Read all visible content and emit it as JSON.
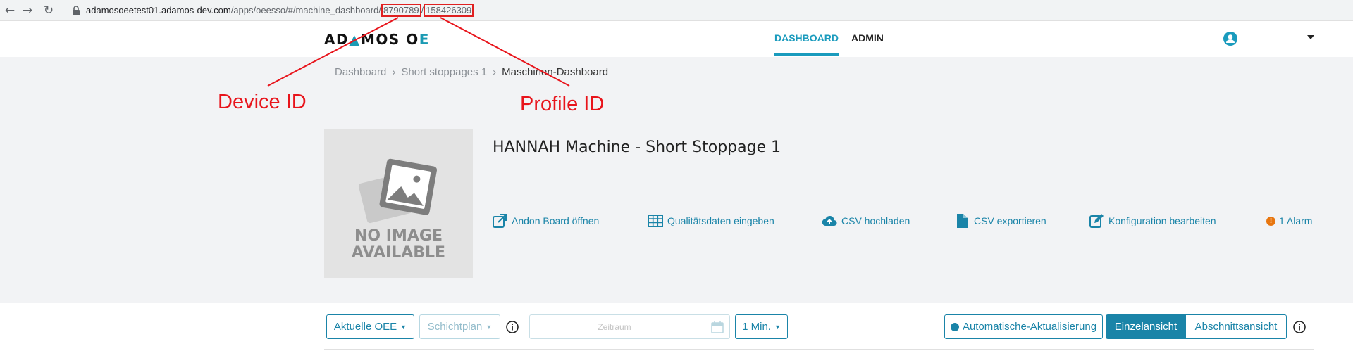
{
  "browser": {
    "back_icon": "back-arrow-icon",
    "forward_icon": "forward-arrow-icon",
    "reload_icon": "reload-icon",
    "url_host": "adamosoeetest01.adamos-dev.com",
    "url_path": "/apps/oeesso/#/machine_dashboard/",
    "url_device_id": "8790789",
    "url_separator": "/",
    "url_profile_id": "158426309"
  },
  "header": {
    "logo_part1": "AD",
    "logo_part2": "MOS O",
    "logo_part3": "E",
    "tabs": [
      {
        "label": "DASHBOARD",
        "active": true
      },
      {
        "label": "ADMIN",
        "active": false
      }
    ],
    "user_icon": "user-circle-icon",
    "menu_icon": "caret-down-icon"
  },
  "breadcrumb": [
    {
      "label": "Dashboard"
    },
    {
      "label": "Short stoppages 1"
    },
    {
      "label": "Maschinen-Dashboard"
    }
  ],
  "annotations": {
    "device_id_label": "Device ID",
    "profile_id_label": "Profile ID",
    "color": "#e8141b"
  },
  "machine": {
    "no_image_line1": "NO IMAGE",
    "no_image_line2": "AVAILABLE",
    "title": "HANNAH Machine - Short Stoppage 1"
  },
  "actions": [
    {
      "label": "Andon Board öffnen",
      "icon": "external-link-icon"
    },
    {
      "label": "Qualitätsdaten eingeben",
      "icon": "table-icon"
    },
    {
      "label": "CSV hochladen",
      "icon": "cloud-upload-icon"
    },
    {
      "label": "CSV exportieren",
      "icon": "file-icon"
    },
    {
      "label": "Konfiguration bearbeiten",
      "icon": "edit-icon"
    }
  ],
  "alarm": {
    "icon_text": "!",
    "label": "1 Alarm"
  },
  "toolbar": {
    "current_oee": "Aktuelle OEE",
    "shift_plan": "Schichtplan",
    "date_placeholder": "Zeitraum",
    "interval": "1 Min.",
    "auto_refresh": "Automatische-Aktualisierung",
    "single_view": "Einzelansicht",
    "section_view": "Abschnittsansicht"
  },
  "colors": {
    "accent": "#1a84a8",
    "brand_teal": "#1a9bbd",
    "background_gray": "#f2f3f5",
    "alarm_orange": "#e8760f"
  }
}
